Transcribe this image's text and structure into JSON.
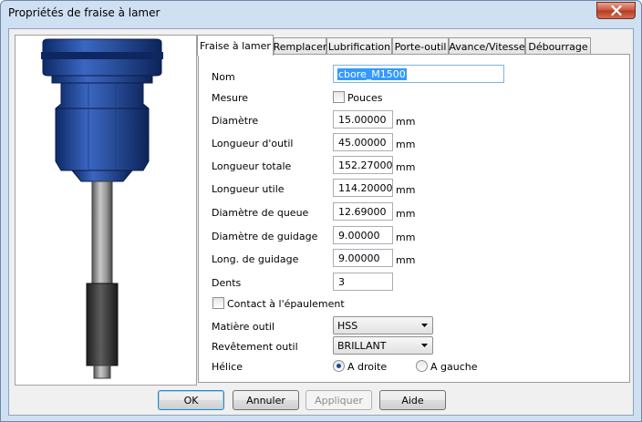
{
  "window": {
    "title": "Propriétés de fraise à lamer"
  },
  "tabs": [
    {
      "label": "Fraise à lamer",
      "active": true
    },
    {
      "label": "Remplacer"
    },
    {
      "label": "Lubrification"
    },
    {
      "label": "Porte-outil"
    },
    {
      "label": "Avance/Vitesse"
    },
    {
      "label": "Débourrage"
    }
  ],
  "form": {
    "name": {
      "label": "Nom",
      "value": "cbore_M1500"
    },
    "measure": {
      "label": "Mesure",
      "checkbox_label": "Pouces",
      "checked": false
    },
    "fields": [
      {
        "label": "Diamètre",
        "value": "15.00000",
        "unit": "mm"
      },
      {
        "label": "Longueur d'outil",
        "value": "45.00000",
        "unit": "mm"
      },
      {
        "label": "Longueur totale",
        "value": "152.27000",
        "unit": "mm"
      },
      {
        "label": "Longueur utile",
        "value": "114.20000",
        "unit": "mm"
      },
      {
        "label": "Diamètre de queue",
        "value": "12.69000",
        "unit": "mm"
      },
      {
        "label": "Diamètre de guidage",
        "value": "9.00000",
        "unit": "mm"
      },
      {
        "label": "Long. de guidage",
        "value": "9.00000",
        "unit": "mm"
      },
      {
        "label": "Dents",
        "value": "3",
        "unit": ""
      }
    ],
    "shoulder_contact": {
      "label": "Contact à l'épaulement",
      "checked": false
    },
    "material": {
      "label": "Matière outil",
      "value": "HSS"
    },
    "coating": {
      "label": "Revêtement outil",
      "value": "BRILLANT"
    },
    "helix": {
      "label": "Hélice",
      "options": [
        "A droite",
        "A gauche"
      ],
      "selected": "A droite"
    }
  },
  "buttons": {
    "ok": "OK",
    "cancel": "Annuler",
    "apply": "Appliquer",
    "help": "Aide"
  },
  "colors": {
    "tool_body": "#2a4f9c",
    "selection": "#3399ff",
    "titlebar": "#cfe0f3"
  }
}
